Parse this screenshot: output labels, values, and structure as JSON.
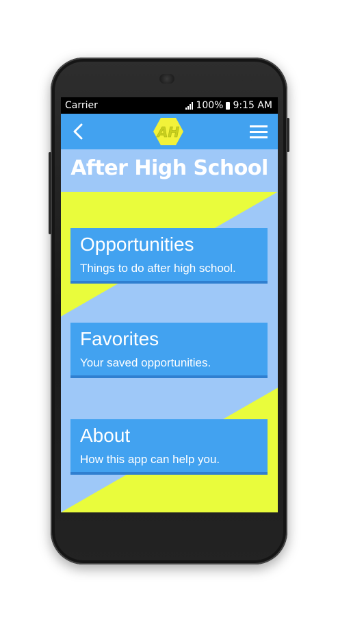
{
  "status_bar": {
    "carrier": "Carrier",
    "battery": "100%",
    "time": "9:15 AM"
  },
  "app_bar": {
    "back_icon": "chevron-left-icon",
    "logo_text": "AH",
    "menu_icon": "hamburger-menu-icon"
  },
  "page": {
    "title": "After High School"
  },
  "cards": [
    {
      "title": "Opportunities",
      "subtitle": "Things to do after high school."
    },
    {
      "title": "Favorites",
      "subtitle": "Your saved opportunities."
    },
    {
      "title": "About",
      "subtitle": "How this app can help you."
    }
  ],
  "colors": {
    "app_bar": "#42a2f0",
    "card": "#42a2f0",
    "background_blue": "#9ec8f8",
    "accent_yellow": "#e9fc3c",
    "logo_yellow": "#f2f23a"
  }
}
